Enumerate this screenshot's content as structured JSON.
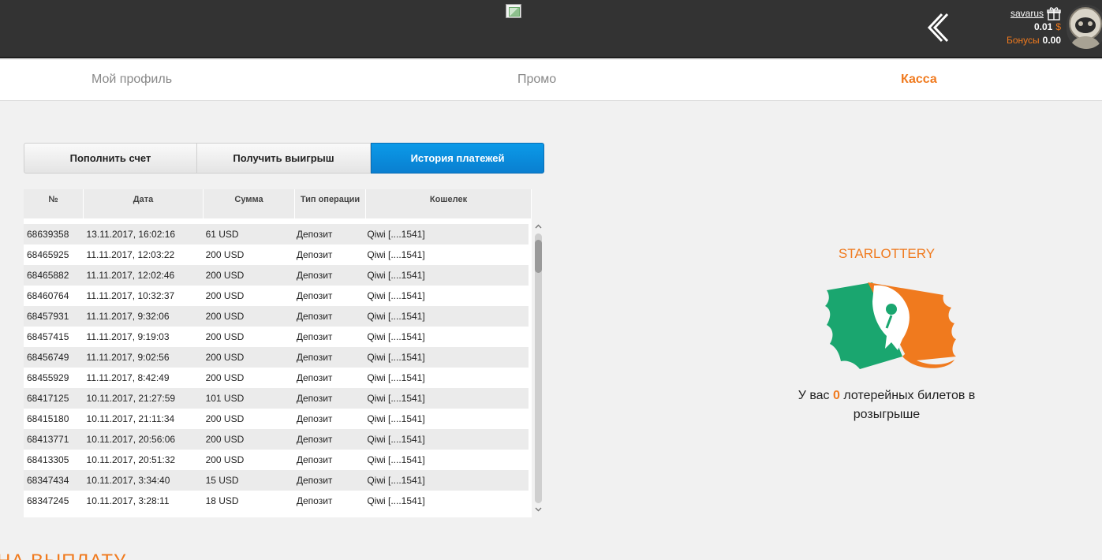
{
  "header": {
    "username": "savarus",
    "balance_value": "0.01",
    "balance_currency": "$",
    "bonus_label": "Бонусы",
    "bonus_value": "0.00"
  },
  "nav": {
    "items": [
      {
        "label": "Мой профиль",
        "active": false
      },
      {
        "label": "Промо",
        "active": false
      },
      {
        "label": "Касса",
        "active": true
      }
    ]
  },
  "tabs": [
    {
      "label": "Пополнить счет",
      "active": false
    },
    {
      "label": "Получить выигрыш",
      "active": false
    },
    {
      "label": "История платежей",
      "active": true
    }
  ],
  "table": {
    "columns": [
      "№",
      "Дата",
      "Сумма",
      "Тип операции",
      "Кошелек"
    ],
    "rows": [
      [
        "68639358",
        "13.11.2017, 16:02:16",
        "61 USD",
        "Депозит",
        "Qiwi [....1541]"
      ],
      [
        "68465925",
        "11.11.2017, 12:03:22",
        "200 USD",
        "Депозит",
        "Qiwi [....1541]"
      ],
      [
        "68465882",
        "11.11.2017, 12:02:46",
        "200 USD",
        "Депозит",
        "Qiwi [....1541]"
      ],
      [
        "68460764",
        "11.11.2017, 10:32:37",
        "200 USD",
        "Депозит",
        "Qiwi [....1541]"
      ],
      [
        "68457931",
        "11.11.2017, 9:32:06",
        "200 USD",
        "Депозит",
        "Qiwi [....1541]"
      ],
      [
        "68457415",
        "11.11.2017, 9:19:03",
        "200 USD",
        "Депозит",
        "Qiwi [....1541]"
      ],
      [
        "68456749",
        "11.11.2017, 9:02:56",
        "200 USD",
        "Депозит",
        "Qiwi [....1541]"
      ],
      [
        "68455929",
        "11.11.2017, 8:42:49",
        "200 USD",
        "Депозит",
        "Qiwi [....1541]"
      ],
      [
        "68417125",
        "10.11.2017, 21:27:59",
        "101 USD",
        "Депозит",
        "Qiwi [....1541]"
      ],
      [
        "68415180",
        "10.11.2017, 21:11:34",
        "200 USD",
        "Депозит",
        "Qiwi [....1541]"
      ],
      [
        "68413771",
        "10.11.2017, 20:56:06",
        "200 USD",
        "Депозит",
        "Qiwi [....1541]"
      ],
      [
        "68413305",
        "10.11.2017, 20:51:32",
        "200 USD",
        "Депозит",
        "Qiwi [....1541]"
      ],
      [
        "68347434",
        "10.11.2017, 3:34:40",
        "15 USD",
        "Депозит",
        "Qiwi [....1541]"
      ],
      [
        "68347245",
        "10.11.2017, 3:28:11",
        "18 USD",
        "Депозит",
        "Qiwi [....1541]"
      ]
    ]
  },
  "lottery": {
    "title": "STARLOTTERY",
    "text_before": "У вас",
    "count": "0",
    "text_after": "лотерейных билетов в розыгрыше"
  },
  "bottom_heading": "НА ВЫПЛАТУ",
  "colors": {
    "accent": "#f07a1e",
    "tab_active": "#0a8fdc",
    "topbar": "#333333",
    "ticket_green": "#1aa66f",
    "ticket_orange": "#f07a1e"
  },
  "icons": {
    "back": "chevron-left-icon",
    "gift": "gift-icon",
    "avatar": "astronaut-avatar",
    "logo": "lottery-ticket-rocket-icon"
  }
}
